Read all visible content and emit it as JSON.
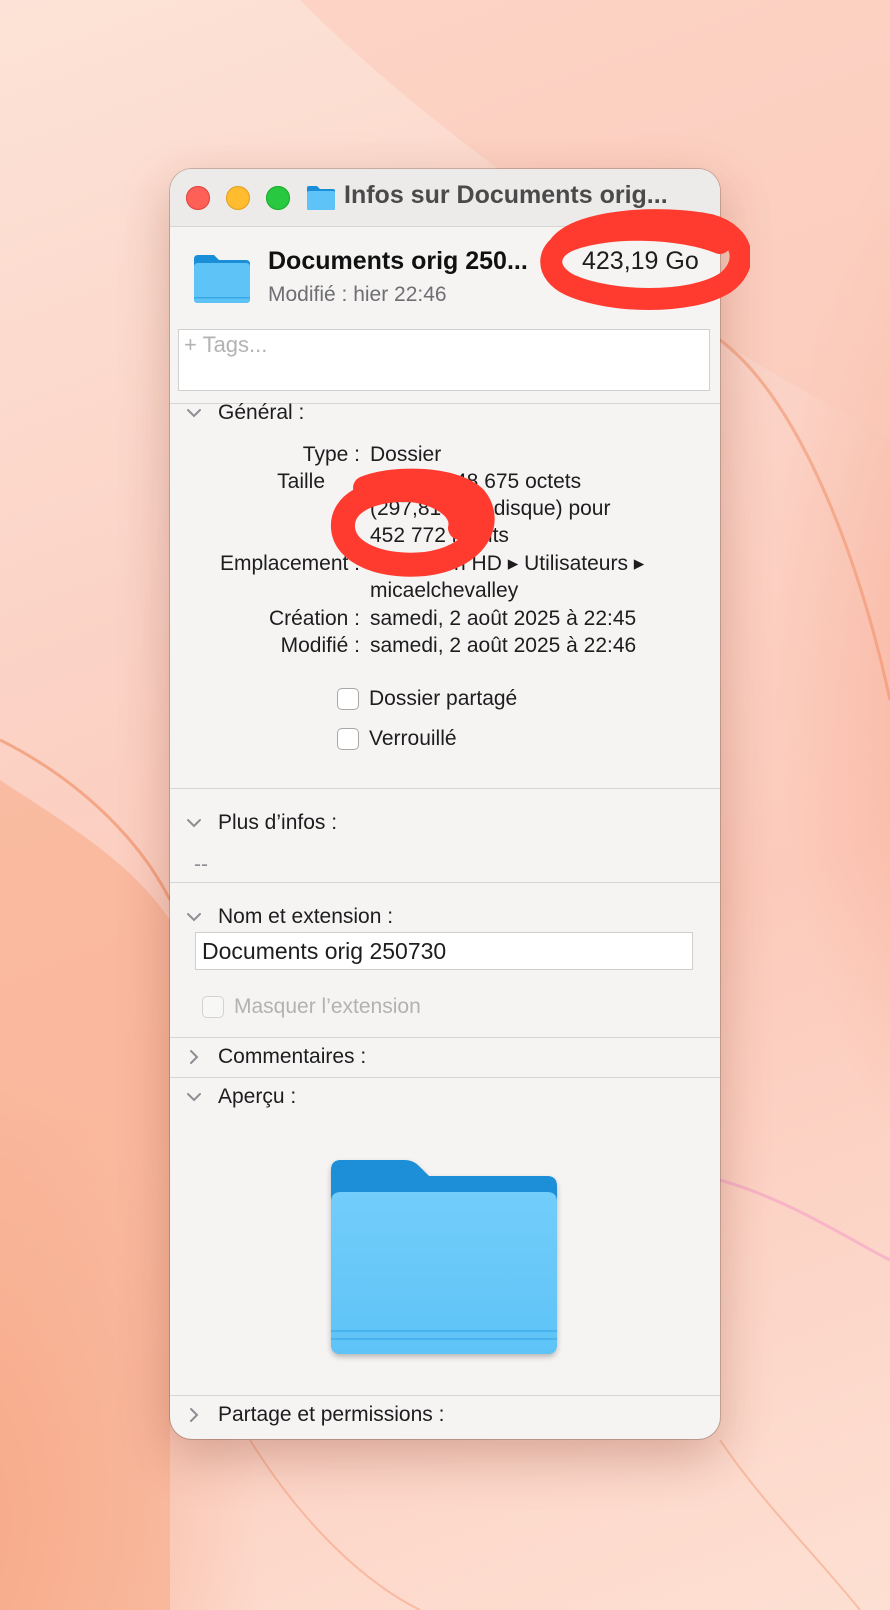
{
  "window": {
    "title": "Infos sur Documents orig...",
    "buttons": {
      "close": "close",
      "minimize": "minimize",
      "zoom": "zoom"
    }
  },
  "header": {
    "name": "Documents orig 250...",
    "size": "423,19 Go",
    "modified": "Modifié : hier 22:46"
  },
  "tags": {
    "placeholder": "+ Tags..."
  },
  "general": {
    "label": "Général :",
    "type_label": "Type :",
    "type_value": "Dossier",
    "size_label": "Taille",
    "size_line1": "48 675 octets",
    "size_line2": "(297,81 G    ur disque) pour",
    "size_line3": "452 772    ments",
    "location_label": "Emplacement :",
    "location_line1": "Macintosh HD ▸ Utilisateurs ▸",
    "location_line2": "micaelchevalley",
    "created_label": "Création :",
    "created_value": "samedi, 2 août 2025 à 22:45",
    "modified_label": "Modifié :",
    "modified_value": "samedi, 2 août 2025 à 22:46",
    "shared_label": "Dossier partagé",
    "locked_label": "Verrouillé"
  },
  "more_info": {
    "label": "Plus d’infos :",
    "value": "--"
  },
  "name_ext": {
    "label": "Nom et extension :",
    "value": "Documents orig 250730",
    "hide_ext_label": "Masquer l’extension"
  },
  "comments": {
    "label": "Commentaires :"
  },
  "preview": {
    "label": "Aperçu :"
  },
  "sharing": {
    "label": "Partage et permissions :"
  },
  "colors": {
    "folder_blue": "#5ec3f7",
    "folder_tab": "#1a8fd8",
    "annotation_red": "#ff3b30",
    "window_bg": "#f5f4f3"
  }
}
